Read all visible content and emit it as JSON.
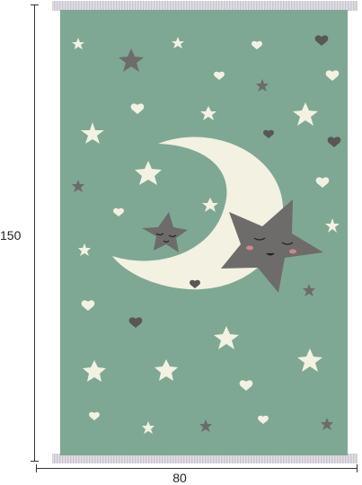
{
  "dimensions": {
    "height_label": "150",
    "width_label": "80"
  },
  "colors": {
    "rug_green": "#7ea893",
    "cream": "#f3f1e2",
    "gray_star": "#6e6b6b",
    "fringe": "#c9c4cf"
  },
  "motifs": {
    "moon": "crescent-moon",
    "big_star": "smiling-star",
    "small_star": "sleepy-star"
  }
}
